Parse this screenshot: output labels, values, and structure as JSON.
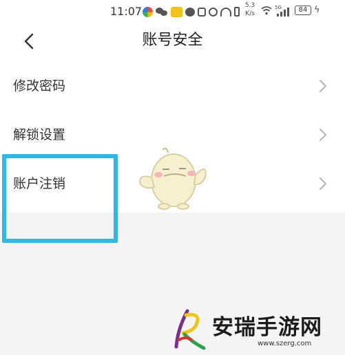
{
  "status_bar": {
    "time": "11:07",
    "speed_value": "5.3",
    "speed_unit": "K/s",
    "network_type": "5G",
    "battery": "84",
    "icons": [
      "colorful-app-icon",
      "wechat-icon",
      "crown-icon",
      "chat-bubble-icon",
      "nfc-icon",
      "alarm-icon",
      "headphones-icon",
      "phone-vibrate-icon",
      "wifi-icon",
      "signal-icon",
      "battery-icon",
      "charging-icon"
    ]
  },
  "header": {
    "title": "账号安全",
    "back_icon": "chevron-left-icon"
  },
  "settings": {
    "items": [
      {
        "label": "修改密码",
        "icon": "chevron-right-icon"
      },
      {
        "label": "解锁设置",
        "icon": "chevron-right-icon"
      },
      {
        "label": "账户注销",
        "icon": "chevron-right-icon"
      }
    ]
  },
  "annotation": {
    "highlight_color": "#2fb8e5"
  },
  "watermark": {
    "title": "安瑞手游网",
    "url": "www.szerg.com"
  },
  "colors": {
    "background": "#f4f4f4",
    "card": "#ffffff",
    "text": "#333333",
    "chevron": "#b5b5b5"
  }
}
